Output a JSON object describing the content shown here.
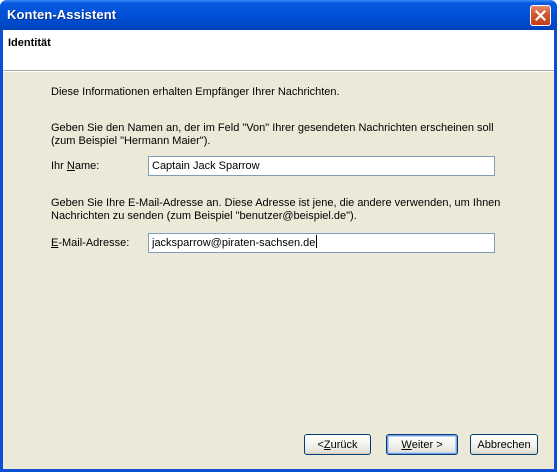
{
  "window": {
    "title": "Konten-Assistent",
    "close_icon": "close-icon"
  },
  "header": {
    "title": "Identität"
  },
  "content": {
    "intro": "Diese Informationen erhalten Empfänger Ihrer Nachrichten.",
    "name_help_line1": "Geben Sie den Namen an, der im Feld \"Von\" Ihrer gesendeten Nachrichten erscheinen soll",
    "name_help_line2": "(zum Beispiel \"Hermann Maier\").",
    "name_label_pre": "Ihr ",
    "name_label_key": "N",
    "name_label_post": "ame:",
    "name_value": "Captain Jack Sparrow",
    "email_help_line1": "Geben Sie Ihre E-Mail-Adresse an. Diese Adresse ist jene, die andere verwenden, um Ihnen",
    "email_help_line2": "Nachrichten zu senden (zum Beispiel \"benutzer@beispiel.de\").",
    "email_label_key": "E",
    "email_label_post": "-Mail-Adresse:",
    "email_value": "jacksparrow@piraten-sachsen.de"
  },
  "buttons": {
    "back_pre": "< ",
    "back_key": "Z",
    "back_post": "urück",
    "next_key": "W",
    "next_post": "eiter >",
    "cancel": "Abbrechen"
  }
}
